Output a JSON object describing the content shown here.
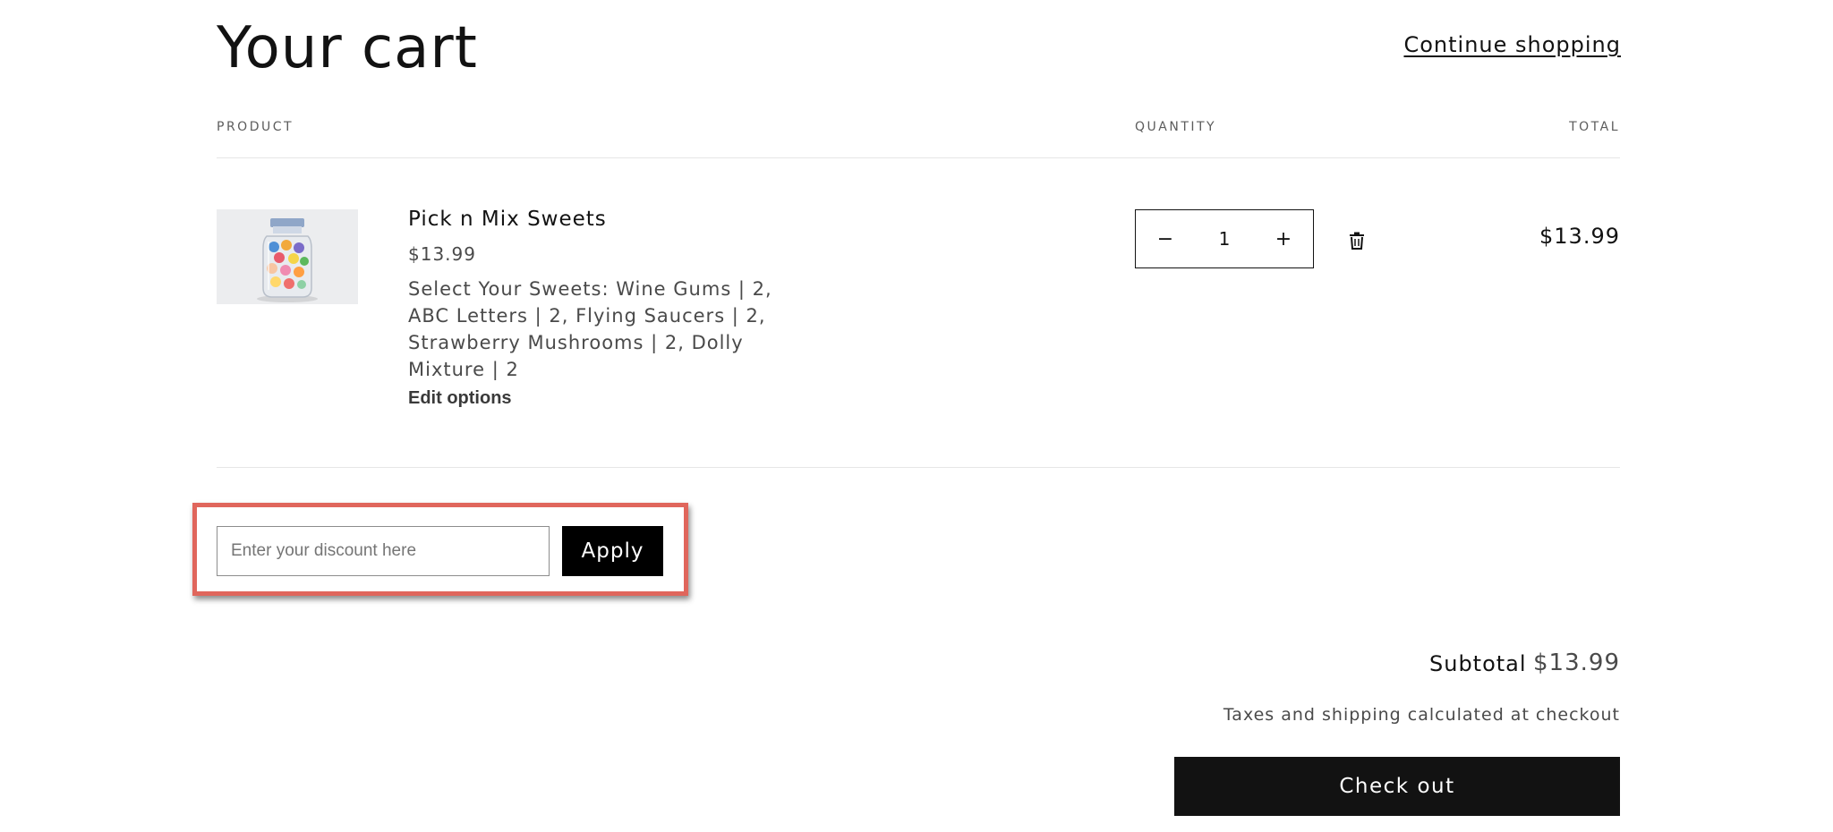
{
  "header": {
    "title": "Your cart",
    "continue_label": "Continue shopping"
  },
  "table": {
    "columns": {
      "product": "PRODUCT",
      "quantity": "QUANTITY",
      "total": "TOTAL"
    }
  },
  "item": {
    "name": "Pick n Mix Sweets",
    "price": "$13.99",
    "options": "Select Your Sweets: Wine Gums | 2, ABC Letters | 2, Flying Saucers | 2, Strawberry Mushrooms | 2, Dolly Mixture | 2",
    "edit_label": "Edit options",
    "quantity": "1",
    "decrease_symbol": "−",
    "increase_symbol": "+",
    "delete_icon": "trash-icon",
    "line_total": "$13.99",
    "image_icon": "candy-jar-image"
  },
  "discount": {
    "placeholder": "Enter your discount here",
    "value": "",
    "apply_label": "Apply",
    "highlight_color": "#e0665c"
  },
  "summary": {
    "subtotal_label": "Subtotal",
    "subtotal_value": "$13.99",
    "tax_note": "Taxes and shipping calculated at checkout",
    "checkout_label": "Check out"
  },
  "colors": {
    "text": "#121212",
    "muted": "#4a4a4a",
    "button_bg": "#121212",
    "divider": "#e6e6e6"
  }
}
